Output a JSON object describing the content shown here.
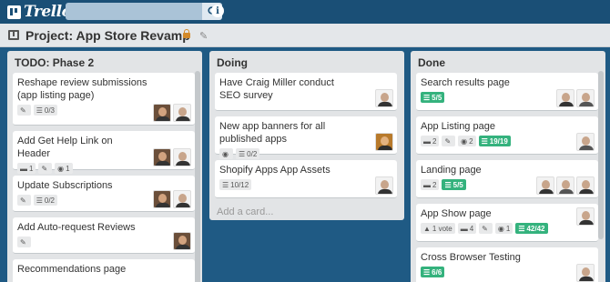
{
  "header": {
    "logo_text": "Trello",
    "search": {
      "value": "",
      "placeholder": ""
    }
  },
  "board": {
    "title": "Project: App Store Revamp"
  },
  "lists": [
    {
      "title": "TODO: Phase 2",
      "cards": [
        {
          "title": "Reshape review submissions (app listing page)",
          "checklist": "0/3"
        },
        {
          "title": "Add Get Help Link on Header",
          "comments": "1",
          "attachments": "1"
        },
        {
          "title": "Update Subscriptions",
          "checklist": "0/2"
        },
        {
          "title": "Add Auto-request Reviews"
        },
        {
          "title": "Recommendations page"
        }
      ]
    },
    {
      "title": "Doing",
      "cards": [
        {
          "title": "Have Craig Miller conduct SEO survey"
        },
        {
          "title": "New app banners for all published apps",
          "checklist": "0/2"
        },
        {
          "title": "Shopify Apps App Assets",
          "checklist": "10/12"
        }
      ],
      "add_card": "Add a card..."
    },
    {
      "title": "Done",
      "cards": [
        {
          "title": "Search results page",
          "checklist": "5/5"
        },
        {
          "title": "App Listing page",
          "comments": "2",
          "attachments": "2",
          "checklist": "19/19"
        },
        {
          "title": "Landing page",
          "comments": "2",
          "checklist": "5/5"
        },
        {
          "title": "App Show page",
          "votes": "1 vote",
          "comments": "4",
          "attachments": "1",
          "checklist": "42/42"
        },
        {
          "title": "Cross Browser Testing",
          "checklist": "6/6"
        }
      ]
    }
  ],
  "colors": {
    "header_bg": "#1a4f76",
    "board_bg": "#1f5a84",
    "list_bg": "#e2e4e6",
    "complete_green": "#34b27d",
    "lock_orange": "#d48a2a"
  },
  "icons": [
    "trello-logo-icon",
    "search-icon",
    "info-icon",
    "board-icon",
    "lock-icon",
    "pencil-icon",
    "checklist-icon",
    "comment-icon",
    "attachment-icon",
    "eye-icon",
    "thumbs-up-icon"
  ]
}
